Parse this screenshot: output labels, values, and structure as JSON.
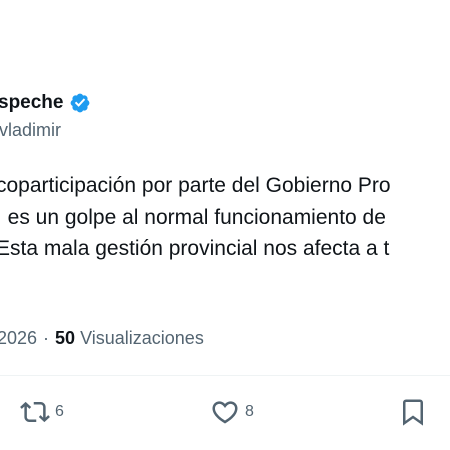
{
  "author": {
    "name": "speche",
    "handle": "vladimir"
  },
  "tweet": {
    "lines": [
      "coparticipación por parte del Gobierno Pro",
      ", es un golpe al normal funcionamiento de",
      "Esta mala gestión provincial nos afecta a t"
    ]
  },
  "meta": {
    "date": "2026",
    "separator": "·",
    "views_count": "50",
    "views_label": "Visualizaciones"
  },
  "actions": {
    "retweet_count": "6",
    "like_count": "8",
    "icons": [
      "retweet-icon",
      "heart-icon",
      "bookmark-icon"
    ]
  },
  "colors": {
    "verified": "#1d9bf0",
    "text": "#0f1419",
    "secondary": "#536471"
  }
}
